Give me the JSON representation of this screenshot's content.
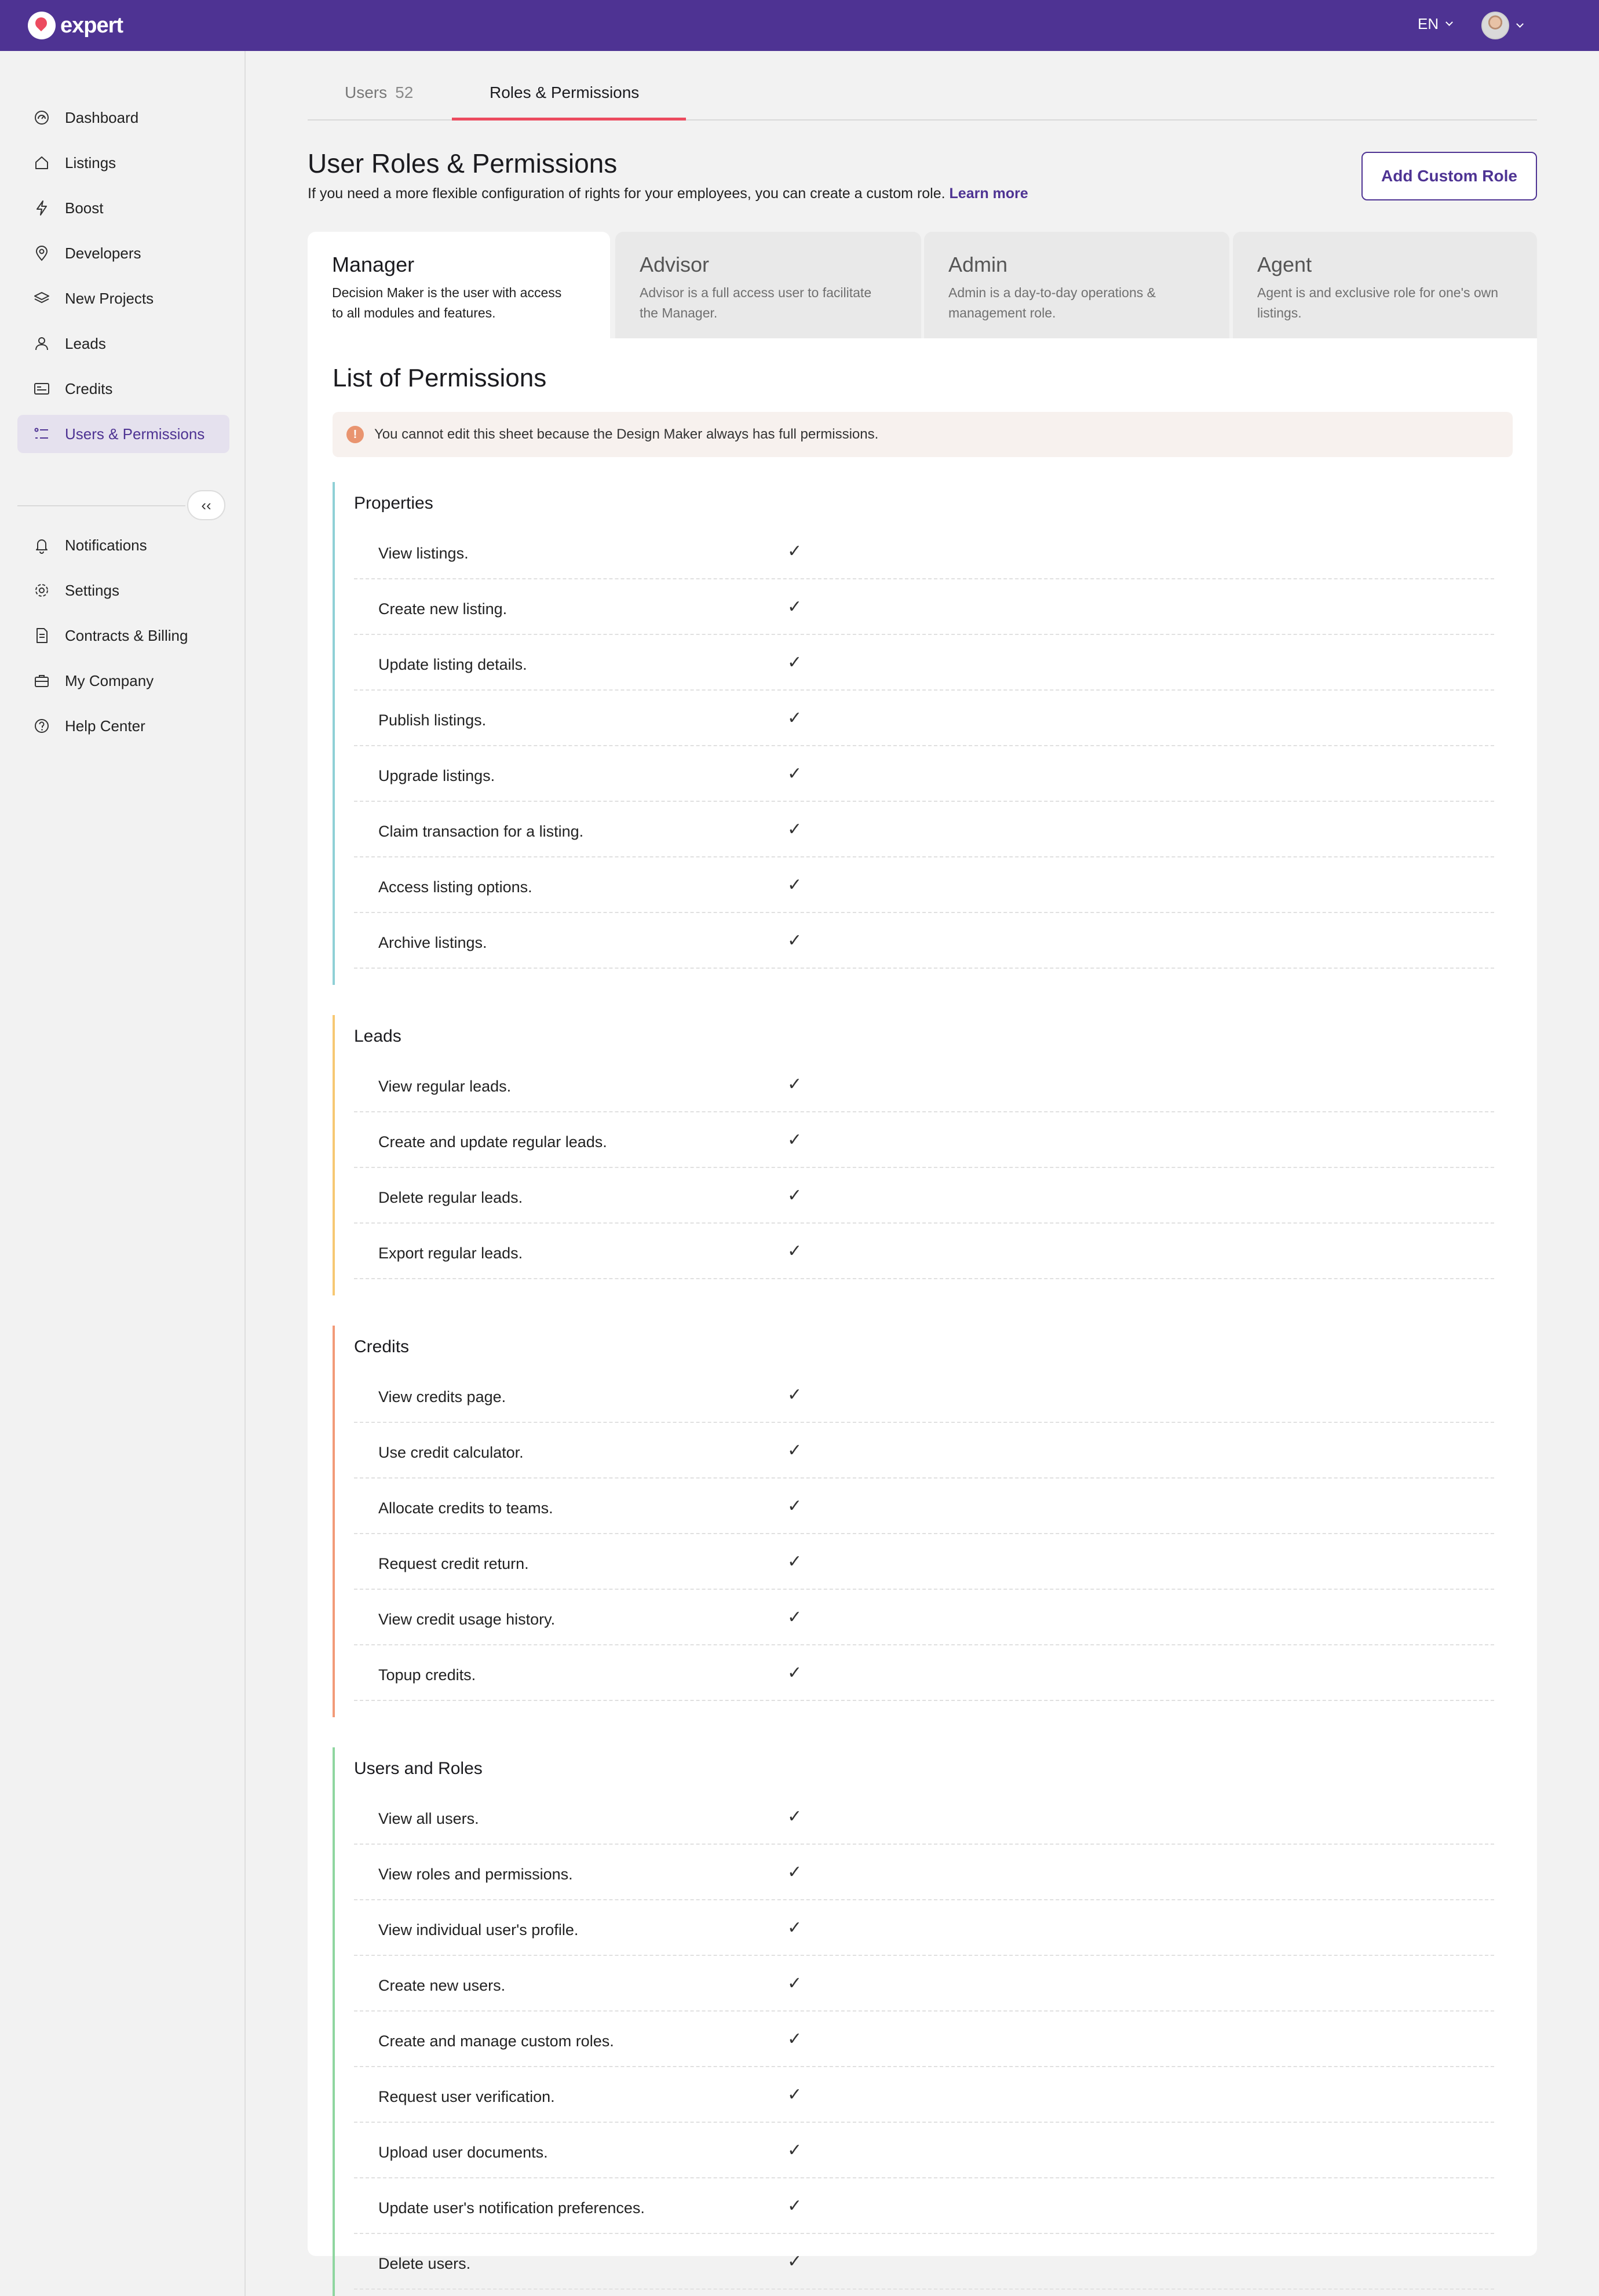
{
  "app": {
    "logo_text": "expert",
    "language": "EN",
    "brand_color": "#4e3393",
    "accent_color": "#ec4b5f"
  },
  "sidebar": {
    "items": [
      {
        "label": "Dashboard",
        "icon": "dashboard-icon"
      },
      {
        "label": "Listings",
        "icon": "home-icon"
      },
      {
        "label": "Boost",
        "icon": "lightning-icon"
      },
      {
        "label": "Developers",
        "icon": "location-pin-icon"
      },
      {
        "label": "New Projects",
        "icon": "layers-icon"
      },
      {
        "label": "Leads",
        "icon": "user-icon"
      },
      {
        "label": "Credits",
        "icon": "credits-icon"
      },
      {
        "label": "Users & Permissions",
        "icon": "list-icon",
        "active": true
      }
    ],
    "collapse_label": "‹‹",
    "bottom_items": [
      {
        "label": "Notifications",
        "icon": "bell-icon"
      },
      {
        "label": "Settings",
        "icon": "gear-icon"
      },
      {
        "label": "Contracts & Billing",
        "icon": "document-icon"
      },
      {
        "label": "My Company",
        "icon": "briefcase-icon"
      },
      {
        "label": "Help Center",
        "icon": "help-icon"
      }
    ]
  },
  "tabs": [
    {
      "label": "Users",
      "count": "52"
    },
    {
      "label": "Roles & Permissions",
      "active": true
    }
  ],
  "header": {
    "title": "User Roles & Permissions",
    "subtitle": "If you need a more flexible configuration of rights for your employees, you can create a custom role.",
    "learn_more": "Learn more",
    "add_button": "Add Custom Role"
  },
  "roles": [
    {
      "name": "Manager",
      "desc": "Decision Maker is the user with access to all modules and features.",
      "active": true
    },
    {
      "name": "Advisor",
      "desc": "Advisor is a full access user to facilitate the Manager."
    },
    {
      "name": "Admin",
      "desc": "Admin is a day-to-day operations & management role."
    },
    {
      "name": "Agent",
      "desc": "Agent is and exclusive role for one's own listings."
    }
  ],
  "permissions": {
    "title": "List of Permissions",
    "notice": "You cannot edit this sheet because the Design Maker always has full permissions.",
    "notice_icon": "!",
    "check": "✓",
    "sections": [
      {
        "title": "Properties",
        "color": "#8fd0d6",
        "items": [
          "View listings.",
          "Create new listing.",
          "Update listing details.",
          "Publish listings.",
          "Upgrade listings.",
          "Claim transaction for a listing.",
          "Access listing options.",
          "Archive listings."
        ]
      },
      {
        "title": "Leads",
        "color": "#f7c873",
        "items": [
          "View regular leads.",
          "Create and update regular leads.",
          "Delete regular leads.",
          "Export regular leads."
        ]
      },
      {
        "title": "Credits",
        "color": "#f29a78",
        "items": [
          "View credits page.",
          "Use credit calculator.",
          "Allocate credits to teams.",
          "Request credit return.",
          "View credit usage history.",
          "Topup credits."
        ]
      },
      {
        "title": "Users and Roles",
        "color": "#8fd6a0",
        "items": [
          "View all users.",
          "View roles and permissions.",
          "View individual user's profile.",
          "Create new users.",
          "Create and manage custom roles.",
          "Request user verification.",
          "Upload user documents.",
          "Update user's notification preferences.",
          "Delete users."
        ]
      }
    ]
  }
}
